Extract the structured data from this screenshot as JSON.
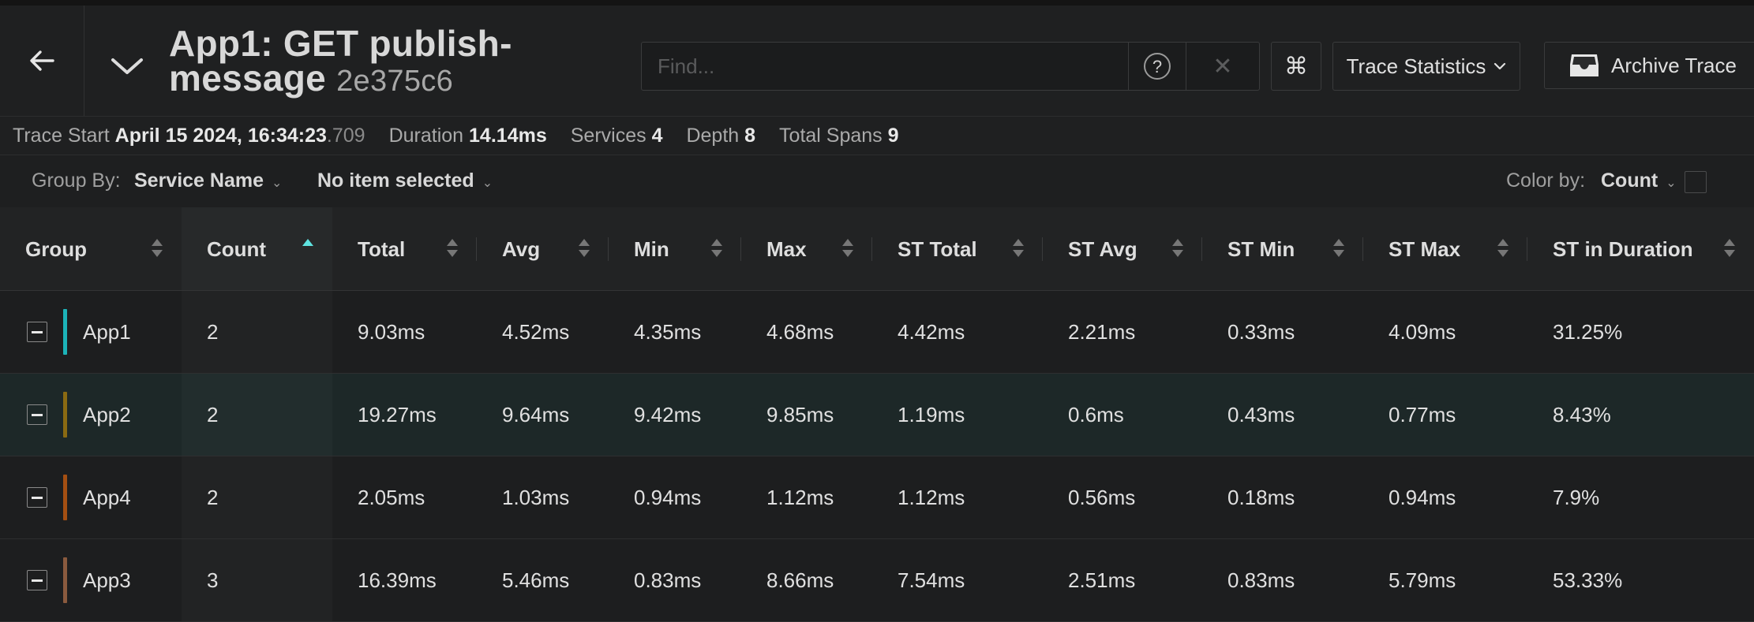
{
  "header": {
    "title": "App1: GET publish-message",
    "trace_id": "2e375c6",
    "search": {
      "placeholder": "Find...",
      "value": ""
    },
    "help_icon": "question-circle-icon",
    "clear_icon": "close-icon",
    "cmd_glyph": "⌘",
    "view_menu_label": "Trace Statistics",
    "archive_label": "Archive Trace"
  },
  "summary": {
    "trace_start_label": "Trace Start",
    "trace_start_value": "April 15 2024, 16:34:23",
    "trace_start_ms": ".709",
    "duration_label": "Duration",
    "duration_value": "14.14ms",
    "services_label": "Services",
    "services_value": "4",
    "depth_label": "Depth",
    "depth_value": "8",
    "total_spans_label": "Total Spans",
    "total_spans_value": "9"
  },
  "groupbar": {
    "group_by_label": "Group By:",
    "group_by_value": "Service Name",
    "second_value": "No item selected",
    "color_by_label": "Color by:",
    "color_by_value": "Count"
  },
  "table": {
    "columns": [
      "Group",
      "Count",
      "Total",
      "Avg",
      "Min",
      "Max",
      "ST Total",
      "ST Avg",
      "ST Min",
      "ST Max",
      "ST in Duration"
    ],
    "sorted_column": "Count",
    "sort_direction": "ascending",
    "rows": [
      {
        "group": "App1",
        "color": "#1cb3b8",
        "count": "2",
        "total": "9.03ms",
        "avg": "4.52ms",
        "min": "4.35ms",
        "max": "4.68ms",
        "st_total": "4.42ms",
        "st_avg": "2.21ms",
        "st_min": "0.33ms",
        "st_max": "4.09ms",
        "st_in_duration": "31.25%"
      },
      {
        "group": "App2",
        "color": "#8a6a12",
        "count": "2",
        "total": "19.27ms",
        "avg": "9.64ms",
        "min": "9.42ms",
        "max": "9.85ms",
        "st_total": "1.19ms",
        "st_avg": "0.6ms",
        "st_min": "0.43ms",
        "st_max": "0.77ms",
        "st_in_duration": "8.43%"
      },
      {
        "group": "App4",
        "color": "#a44f12",
        "count": "2",
        "total": "2.05ms",
        "avg": "1.03ms",
        "min": "0.94ms",
        "max": "1.12ms",
        "st_total": "1.12ms",
        "st_avg": "0.56ms",
        "st_min": "0.18ms",
        "st_max": "0.94ms",
        "st_in_duration": "7.9%"
      },
      {
        "group": "App3",
        "color": "#8a5a3e",
        "count": "3",
        "total": "16.39ms",
        "avg": "5.46ms",
        "min": "0.83ms",
        "max": "8.66ms",
        "st_total": "7.54ms",
        "st_avg": "2.51ms",
        "st_min": "0.83ms",
        "st_max": "5.79ms",
        "st_in_duration": "53.33%"
      }
    ]
  }
}
